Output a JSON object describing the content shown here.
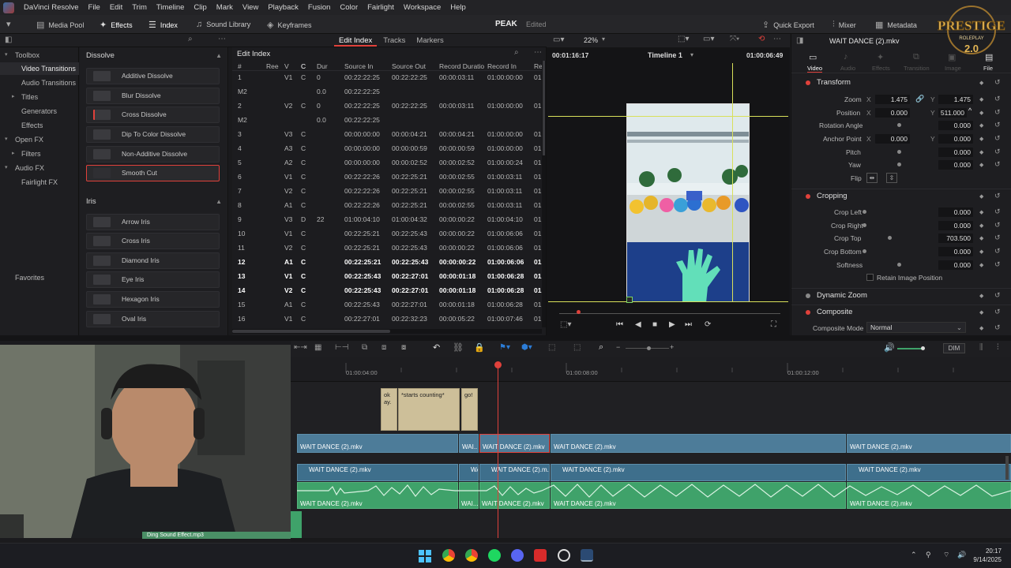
{
  "menu": {
    "app_name": "DaVinci Resolve",
    "items": [
      "File",
      "Edit",
      "Trim",
      "Timeline",
      "Clip",
      "Mark",
      "View",
      "Playback",
      "Fusion",
      "Color",
      "Fairlight",
      "Workspace",
      "Help"
    ]
  },
  "toolbar": {
    "media_pool": "Media Pool",
    "effects": "Effects",
    "index": "Index",
    "sound_library": "Sound Library",
    "keyframes": "Keyframes",
    "project_title": "PEAK",
    "project_status": "Edited",
    "quick_export": "Quick Export",
    "mixer": "Mixer",
    "metadata": "Metadata",
    "inspector": "Inspector"
  },
  "path_tabs": [
    {
      "label": "Edit Index",
      "active": true
    },
    {
      "label": "Tracks",
      "active": false
    },
    {
      "label": "Markers",
      "active": false
    }
  ],
  "left_nav": {
    "items": [
      {
        "label": "Toolbox",
        "caret": "v",
        "indent": 0,
        "selected": false
      },
      {
        "label": "Video Transitions",
        "caret": "",
        "indent": 1,
        "selected": true
      },
      {
        "label": "Audio Transitions",
        "caret": "",
        "indent": 1,
        "selected": false
      },
      {
        "label": "Titles",
        "caret": ">",
        "indent": 1,
        "selected": false
      },
      {
        "label": "Generators",
        "caret": "",
        "indent": 1,
        "selected": false
      },
      {
        "label": "Effects",
        "caret": "",
        "indent": 1,
        "selected": false
      },
      {
        "label": "Open FX",
        "caret": "v",
        "indent": 0,
        "selected": false
      },
      {
        "label": "Filters",
        "caret": ">",
        "indent": 1,
        "selected": false
      },
      {
        "label": "Audio FX",
        "caret": "v",
        "indent": 0,
        "selected": false
      },
      {
        "label": "Fairlight FX",
        "caret": "",
        "indent": 1,
        "selected": false
      }
    ],
    "favorites": "Favorites"
  },
  "effects": {
    "dissolve_title": "Dissolve",
    "dissolve_items": [
      "Additive Dissolve",
      "Blur Dissolve",
      "Cross Dissolve",
      "Dip To Color Dissolve",
      "Non-Additive Dissolve",
      "Smooth Cut"
    ],
    "dissolve_selected_index": 5,
    "iris_title": "Iris",
    "iris_items": [
      "Arrow Iris",
      "Cross Iris",
      "Diamond Iris",
      "Eye Iris",
      "Hexagon Iris",
      "Oval Iris"
    ]
  },
  "edit_index": {
    "title": "Edit Index",
    "columns": [
      "#",
      "Ree",
      "V",
      "C",
      "Dur",
      "Source In",
      "Source Out",
      "Record Duratio",
      "Record In",
      "Re"
    ],
    "rows": [
      [
        "1",
        "",
        "V1",
        "C",
        "0",
        "00:22:22:25",
        "00:22:22:25",
        "00:00:03:11",
        "01:00:00:00",
        "01"
      ],
      [
        "M2",
        "",
        "",
        "",
        "0.0",
        "00:22:22:25",
        "",
        "",
        "",
        ""
      ],
      [
        "2",
        "",
        "V2",
        "C",
        "0",
        "00:22:22:25",
        "00:22:22:25",
        "00:00:03:11",
        "01:00:00:00",
        "01"
      ],
      [
        "M2",
        "",
        "",
        "",
        "0.0",
        "00:22:22:25",
        "",
        "",
        "",
        ""
      ],
      [
        "3",
        "",
        "V3",
        "C",
        "",
        "00:00:00:00",
        "00:00:04:21",
        "00:00:04:21",
        "01:00:00:00",
        "01"
      ],
      [
        "4",
        "",
        "A3",
        "C",
        "",
        "00:00:00:00",
        "00:00:00:59",
        "00:00:00:59",
        "01:00:00:00",
        "01"
      ],
      [
        "5",
        "",
        "A2",
        "C",
        "",
        "00:00:00:00",
        "00:00:02:52",
        "00:00:02:52",
        "01:00:00:24",
        "01"
      ],
      [
        "6",
        "",
        "V1",
        "C",
        "",
        "00:22:22:26",
        "00:22:25:21",
        "00:00:02:55",
        "01:00:03:11",
        "01"
      ],
      [
        "7",
        "",
        "V2",
        "C",
        "",
        "00:22:22:26",
        "00:22:25:21",
        "00:00:02:55",
        "01:00:03:11",
        "01"
      ],
      [
        "8",
        "",
        "A1",
        "C",
        "",
        "00:22:22:26",
        "00:22:25:21",
        "00:00:02:55",
        "01:00:03:11",
        "01"
      ],
      [
        "9",
        "",
        "V3",
        "D",
        "22",
        "01:00:04:10",
        "01:00:04:32",
        "00:00:00:22",
        "01:00:04:10",
        "01"
      ],
      [
        "10",
        "",
        "V1",
        "C",
        "",
        "00:22:25:21",
        "00:22:25:43",
        "00:00:00:22",
        "01:00:06:06",
        "01"
      ],
      [
        "11",
        "",
        "V2",
        "C",
        "",
        "00:22:25:21",
        "00:22:25:43",
        "00:00:00:22",
        "01:00:06:06",
        "01"
      ],
      [
        "12",
        "",
        "A1",
        "C",
        "",
        "00:22:25:21",
        "00:22:25:43",
        "00:00:00:22",
        "01:00:06:06",
        "01"
      ],
      [
        "13",
        "",
        "V1",
        "C",
        "",
        "00:22:25:43",
        "00:22:27:01",
        "00:00:01:18",
        "01:00:06:28",
        "01"
      ],
      [
        "14",
        "",
        "V2",
        "C",
        "",
        "00:22:25:43",
        "00:22:27:01",
        "00:00:01:18",
        "01:00:06:28",
        "01"
      ],
      [
        "15",
        "",
        "A1",
        "C",
        "",
        "00:22:25:43",
        "00:22:27:01",
        "00:00:01:18",
        "01:00:06:28",
        "01"
      ],
      [
        "16",
        "",
        "V1",
        "C",
        "",
        "00:22:27:01",
        "00:22:32:23",
        "00:00:05:22",
        "01:00:07:46",
        "01"
      ]
    ],
    "highlighted_rows": [
      14,
      15,
      16
    ]
  },
  "viewer": {
    "zoom": "22%",
    "timecode_left": "00:01:16:17",
    "timeline_name": "Timeline 1",
    "timecode_right": "01:00:06:49"
  },
  "inspector": {
    "clip_name": "WAIT DANCE (2).mkv",
    "tabs": [
      "Video",
      "Audio",
      "Effects",
      "Transition",
      "Image",
      "File"
    ],
    "transform_title": "Transform",
    "zoom_label": "Zoom",
    "zoom_x": "1.475",
    "zoom_y": "1.475",
    "position_label": "Position",
    "position_x": "0.000",
    "position_y": "511.000",
    "rotation_label": "Rotation Angle",
    "rotation": "0.000",
    "anchor_label": "Anchor Point",
    "anchor_x": "0.000",
    "anchor_y": "0.000",
    "pitch_label": "Pitch",
    "pitch": "0.000",
    "yaw_label": "Yaw",
    "yaw": "0.000",
    "flip_label": "Flip",
    "axis_x": "X",
    "axis_y": "Y",
    "cropping_title": "Cropping",
    "crop_left_label": "Crop Left",
    "crop_left": "0.000",
    "crop_right_label": "Crop Right",
    "crop_right": "0.000",
    "crop_top_label": "Crop Top",
    "crop_top": "703.500",
    "crop_bottom_label": "Crop Bottom",
    "crop_bottom": "0.000",
    "softness_label": "Softness",
    "softness": "0.000",
    "retain_label": "Retain Image Position",
    "dynamic_zoom_title": "Dynamic Zoom",
    "composite_title": "Composite",
    "composite_mode_label": "Composite Mode",
    "composite_mode": "Normal"
  },
  "timeline": {
    "ruler_labels": [
      "01:00:04:00",
      "01:00:08:00",
      "01:00:12:00"
    ],
    "dim_label": "DIM",
    "subtitles": [
      "ok ay.",
      "*starts counting*",
      "go!"
    ],
    "v2_clips": [
      "WAIT DANCE (2).mkv",
      "WAI...",
      "WAIT DANCE (2).mkv",
      "WAIT DANCE (2).mkv",
      "WAIT DANCE (2).mkv"
    ],
    "v1_clips": [
      "WAIT DANCE (2).mkv",
      "WAI...",
      "WAIT DANCE (2).m...",
      "WAIT DANCE (2).mkv",
      "WAIT DANCE (2).mkv"
    ],
    "a1_clips": [
      "WAIT DANCE (2).mkv",
      "WAI...",
      "WAIT DANCE (2).mkv",
      "WAIT DANCE (2).mkv",
      "WAIT DANCE (2).mkv"
    ],
    "audio_clip_bottom": "Ding Sound Effect.mp3"
  },
  "watermark": {
    "line1": "PRESTIGE",
    "line2": "ROLEPLAY",
    "line3": "2.0"
  },
  "taskbar": {
    "time": "20:17",
    "date": "9/14/2025"
  },
  "colors": {
    "accent_red": "#e0413b",
    "video_clip": "#4d7c99",
    "audio_clip": "#3fa26a",
    "subtitle_clip": "#cdbf99",
    "playhead": "#e0413b"
  }
}
